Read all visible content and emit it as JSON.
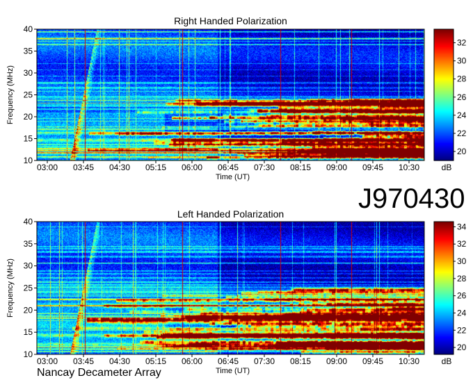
{
  "observation_id": "J970430",
  "credit": "Nancay Decameter Array",
  "chart_data": [
    {
      "type": "heatmap",
      "title": "Right Handed Polarization",
      "xlabel": "Time (UT)",
      "ylabel": "Frequency (MHz)",
      "x_ticks": [
        "03:00",
        "03:45",
        "04:30",
        "05:15",
        "06:00",
        "06:45",
        "07:30",
        "08:15",
        "09:00",
        "09:45",
        "10:30"
      ],
      "y_ticks": [
        10,
        15,
        20,
        25,
        30,
        35,
        40
      ],
      "ylim": [
        10,
        40
      ],
      "colorbar": {
        "label": "dB",
        "ticks": [
          20,
          22,
          24,
          26,
          28,
          30,
          32
        ],
        "range": [
          19,
          33.5
        ]
      },
      "colormap": "jet"
    },
    {
      "type": "heatmap",
      "title": "Left Handed Polarization",
      "xlabel": "Time (UT)",
      "ylabel": "Frequency (MHz)",
      "x_ticks": [
        "03:00",
        "03:45",
        "04:30",
        "05:15",
        "06:00",
        "06:45",
        "07:30",
        "08:15",
        "09:00",
        "09:45",
        "10:30"
      ],
      "y_ticks": [
        10,
        15,
        20,
        25,
        30,
        35,
        40
      ],
      "ylim": [
        10,
        40
      ],
      "colorbar": {
        "label": "dB",
        "ticks": [
          20,
          22,
          24,
          26,
          28,
          30,
          32,
          34
        ],
        "range": [
          19.2,
          34.6
        ]
      },
      "colormap": "jet"
    }
  ]
}
